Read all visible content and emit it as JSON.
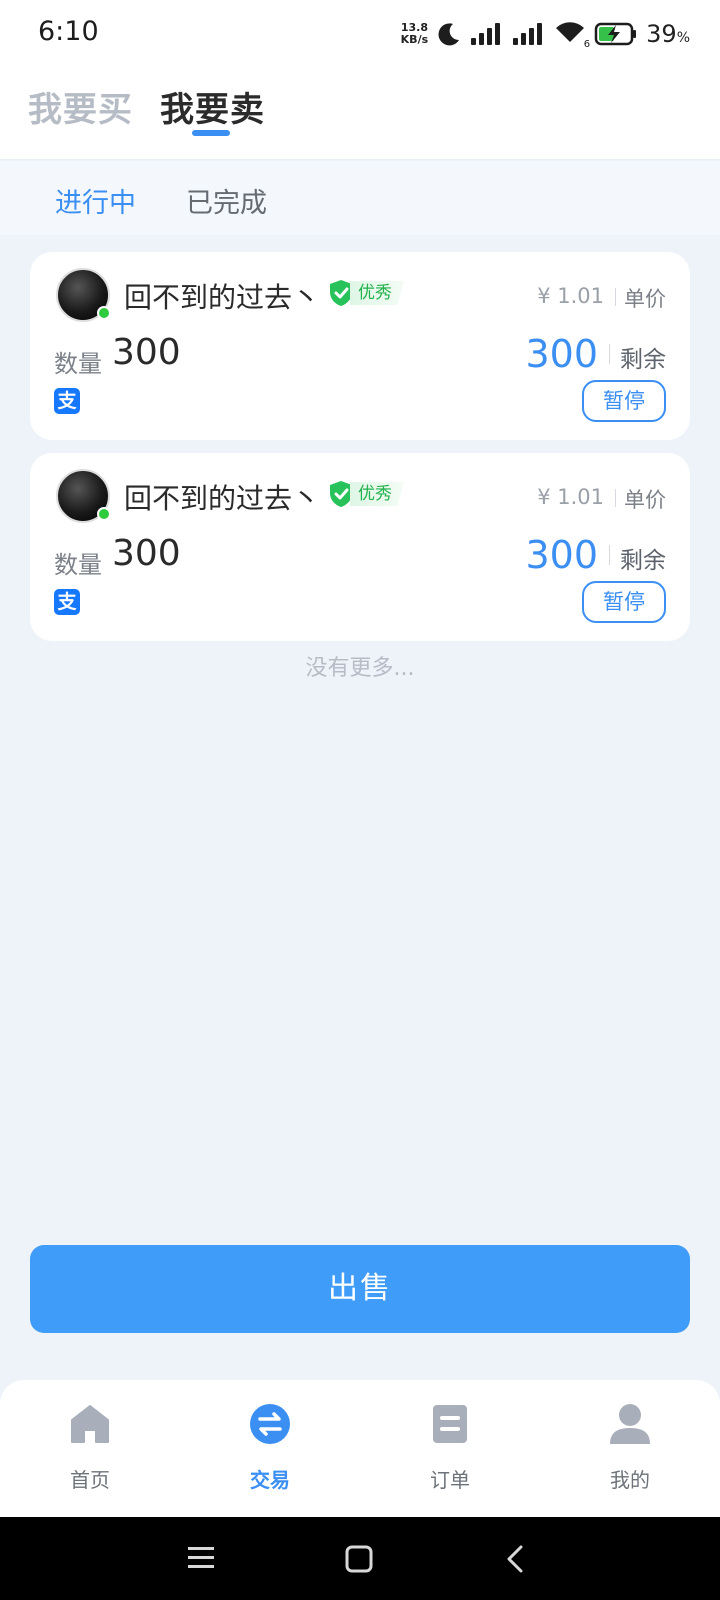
{
  "status_bar": {
    "time": "6:10",
    "net_speed_value": "13.8",
    "net_speed_unit": "KB/s",
    "wifi_sub": "6",
    "battery_percent": "39",
    "battery_unit": "%"
  },
  "top_tabs": {
    "buy": "我要买",
    "sell": "我要卖"
  },
  "sub_tabs": {
    "in_progress": "进行中",
    "completed": "已完成"
  },
  "listings": [
    {
      "username": "回不到的过去丶",
      "badge": "优秀",
      "price": "¥ 1.01",
      "price_label": "单价",
      "quantity_label": "数量",
      "quantity": "300",
      "remaining": "300",
      "remaining_label": "剩余",
      "payment_icon": "支",
      "action": "暂停"
    },
    {
      "username": "回不到的过去丶",
      "badge": "优秀",
      "price": "¥ 1.01",
      "price_label": "单价",
      "quantity_label": "数量",
      "quantity": "300",
      "remaining": "300",
      "remaining_label": "剩余",
      "payment_icon": "支",
      "action": "暂停"
    }
  ],
  "no_more_text": "没有更多...",
  "sell_button": "出售",
  "bottom_nav": {
    "home": "首页",
    "trade": "交易",
    "orders": "订单",
    "mine": "我的"
  },
  "colors": {
    "accent": "#3b8ff3",
    "sell_button": "#3f9cf8",
    "badge_green": "#22b14c",
    "online_green": "#2fcb3e",
    "alipay_blue": "#1677ff"
  }
}
